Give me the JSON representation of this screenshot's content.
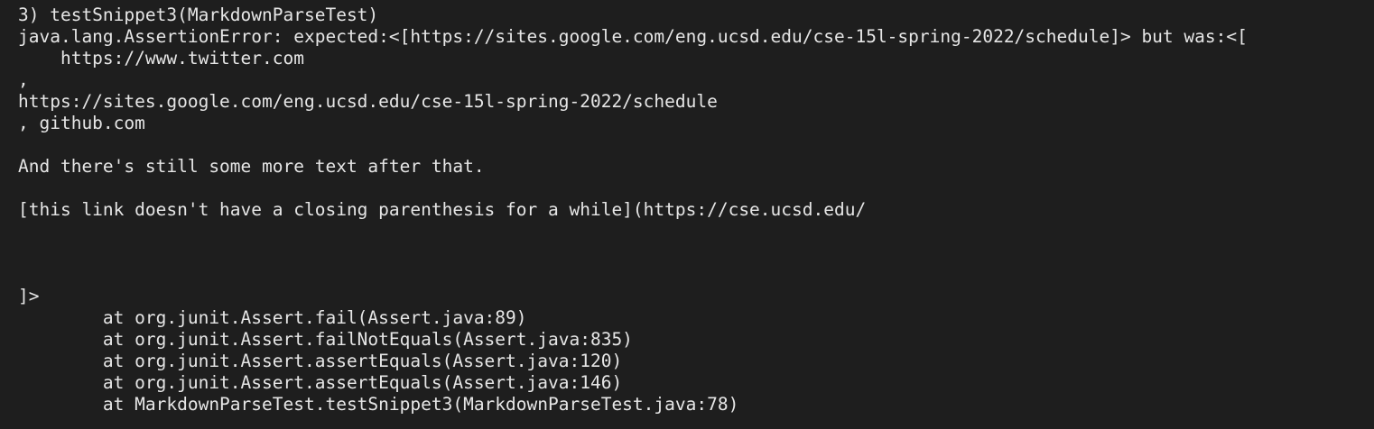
{
  "terminal": {
    "lines": [
      "",
      "3) testSnippet3(MarkdownParseTest)",
      "java.lang.AssertionError: expected:<[https://sites.google.com/eng.ucsd.edu/cse-15l-spring-2022/schedule]> but was:<[",
      "    https://www.twitter.com",
      ",",
      "https://sites.google.com/eng.ucsd.edu/cse-15l-spring-2022/schedule",
      ", github.com",
      "",
      "And there's still some more text after that.",
      "",
      "[this link doesn't have a closing parenthesis for a while](https://cse.ucsd.edu/",
      "",
      "",
      "",
      "]>",
      "        at org.junit.Assert.fail(Assert.java:89)",
      "        at org.junit.Assert.failNotEquals(Assert.java:835)",
      "        at org.junit.Assert.assertEquals(Assert.java:120)",
      "        at org.junit.Assert.assertEquals(Assert.java:146)",
      "        at MarkdownParseTest.testSnippet3(MarkdownParseTest.java:78)"
    ]
  }
}
